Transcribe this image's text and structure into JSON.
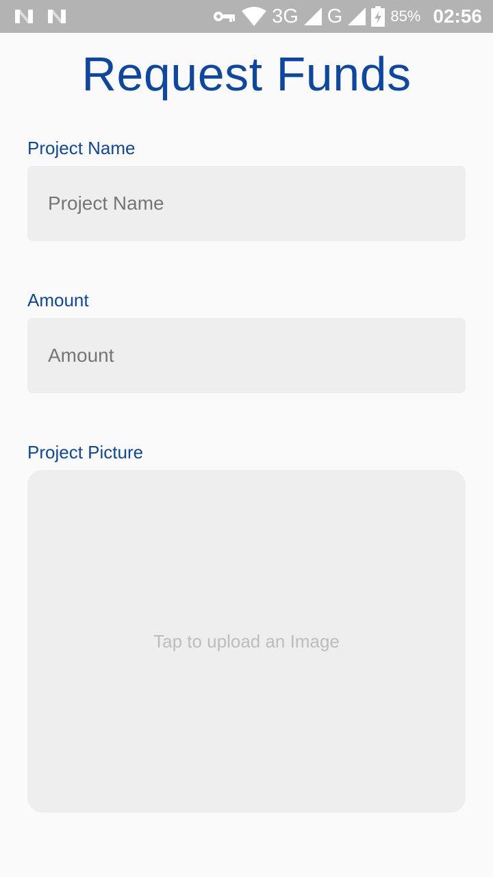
{
  "status_bar": {
    "network_3g": "3G",
    "network_g": "G",
    "battery_percent": "85%",
    "time": "02:56",
    "icons": [
      "n-notification-icon",
      "n-notification-icon",
      "vpn-key-icon",
      "wifi-icon",
      "signal-icon",
      "signal-icon",
      "battery-charging-icon"
    ]
  },
  "page": {
    "title": "Request Funds"
  },
  "form": {
    "project_name": {
      "label": "Project Name",
      "placeholder": "Project Name",
      "value": ""
    },
    "amount": {
      "label": "Amount",
      "placeholder": "Amount",
      "value": ""
    },
    "project_picture": {
      "label": "Project Picture",
      "hint": "Tap to upload an Image"
    }
  },
  "colors": {
    "accent": "#0d47a1",
    "field_bg": "#eeeeee",
    "background": "#fafafa",
    "status_bar": "#b3b3b3"
  }
}
